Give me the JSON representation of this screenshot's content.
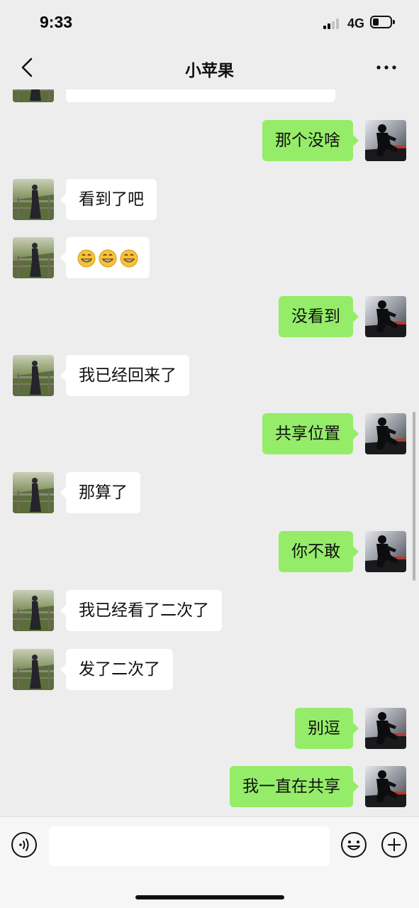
{
  "status_bar": {
    "time": "9:33",
    "network": "4G"
  },
  "header": {
    "title": "小苹果"
  },
  "messages": [
    {
      "side": "in",
      "text": ""
    },
    {
      "side": "out",
      "text": "那个没啥"
    },
    {
      "side": "in",
      "text": "看到了吧"
    },
    {
      "side": "in",
      "emoji_count": 3,
      "emoji": "grinning-face-emoji"
    },
    {
      "side": "out",
      "text": "没看到"
    },
    {
      "side": "in",
      "text": "我已经回来了"
    },
    {
      "side": "out",
      "text": "共享位置"
    },
    {
      "side": "in",
      "text": "那算了"
    },
    {
      "side": "out",
      "text": "你不敢"
    },
    {
      "side": "in",
      "text": "我已经看了二次了"
    },
    {
      "side": "in",
      "text": "发了二次了"
    },
    {
      "side": "out",
      "text": "别逗"
    },
    {
      "side": "out",
      "text": "我一直在共享"
    }
  ],
  "input_bar": {
    "value": "",
    "placeholder": ""
  },
  "colors": {
    "background": "#ededed",
    "outgoing_bubble": "#95ec69",
    "incoming_bubble": "#ffffff"
  }
}
